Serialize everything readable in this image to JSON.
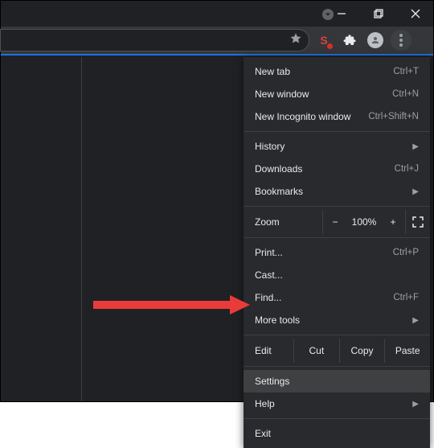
{
  "menu": {
    "new_tab": "New tab",
    "new_tab_key": "Ctrl+T",
    "new_window": "New window",
    "new_window_key": "Ctrl+N",
    "incognito": "New Incognito window",
    "incognito_key": "Ctrl+Shift+N",
    "history": "History",
    "downloads": "Downloads",
    "downloads_key": "Ctrl+J",
    "bookmarks": "Bookmarks",
    "zoom_label": "Zoom",
    "zoom_minus": "−",
    "zoom_pct": "100%",
    "zoom_plus": "+",
    "print": "Print...",
    "print_key": "Ctrl+P",
    "cast": "Cast...",
    "find": "Find...",
    "find_key": "Ctrl+F",
    "more_tools": "More tools",
    "edit_label": "Edit",
    "cut": "Cut",
    "copy": "Copy",
    "paste": "Paste",
    "settings": "Settings",
    "help": "Help",
    "exit": "Exit"
  },
  "ext_s_letter": "S"
}
